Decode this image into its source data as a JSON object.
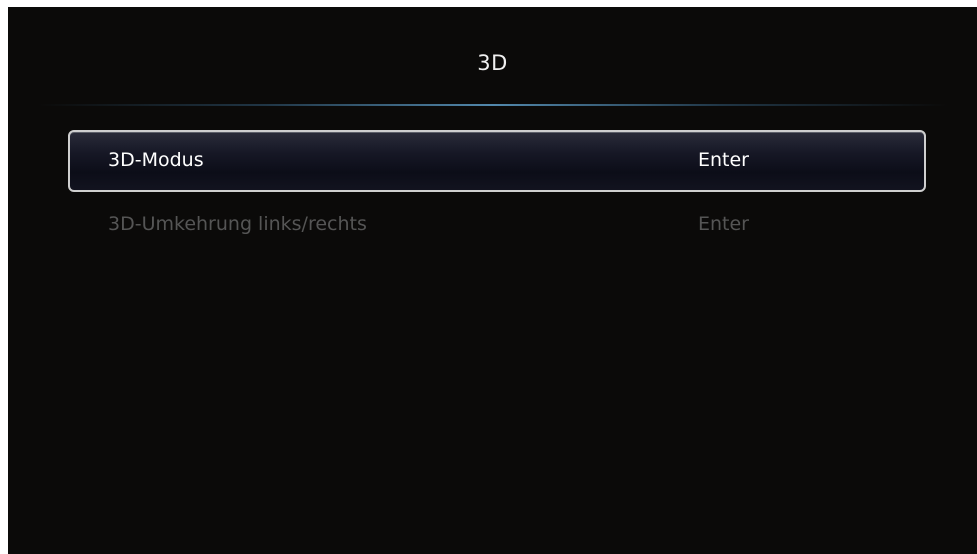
{
  "header": {
    "title": "3D"
  },
  "menu": {
    "items": [
      {
        "label": "3D-Modus",
        "value": "Enter",
        "selected": true
      },
      {
        "label": "3D-Umkehrung links/rechts",
        "value": "Enter",
        "selected": false
      }
    ]
  },
  "colors": {
    "background": "#0b0a09",
    "text_active": "#ffffff",
    "text_inactive": "#555555",
    "selection_border": "#cfcfcf",
    "divider_accent": "#5a96be"
  }
}
